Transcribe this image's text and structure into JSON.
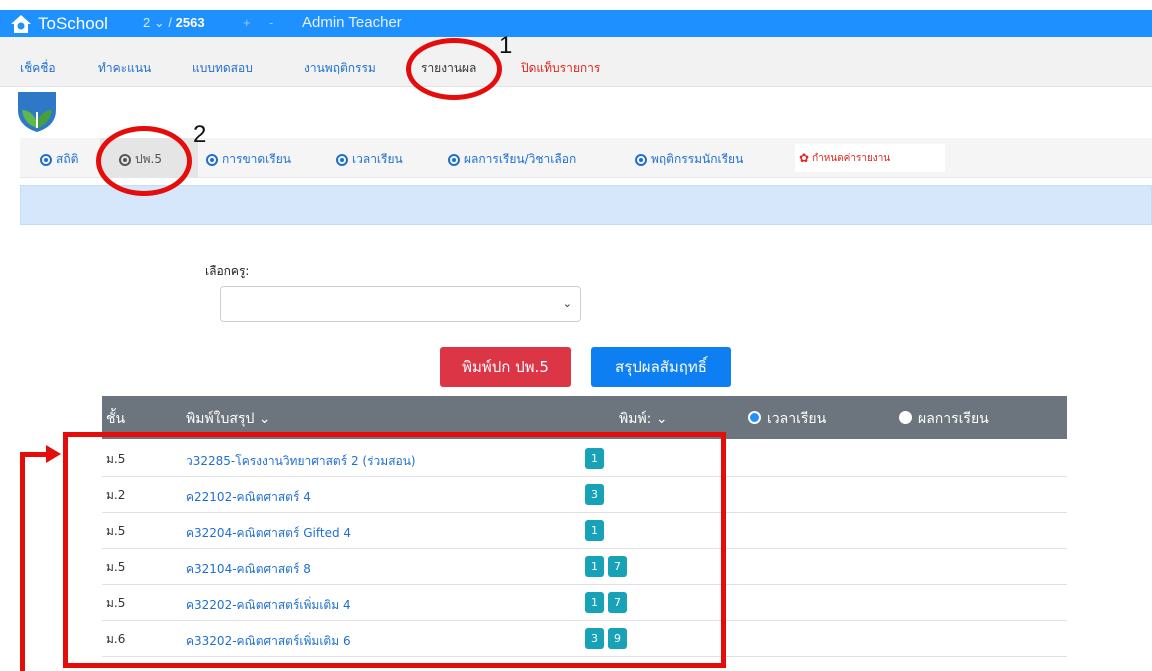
{
  "topbar": {
    "brand": "ToSchool",
    "term_sem": "2",
    "term_chev": "⌄",
    "term_sep": "/",
    "term_year": "2563",
    "plus": "+",
    "minus": "-",
    "roles": "Admin  Teacher"
  },
  "menu": {
    "items": [
      "เช็คชื่อ",
      "ทำคะแนน",
      "แบบทดสอบ",
      "งานพฤติกรรม",
      "รายงานผล",
      "ปิดแท็บรายการ"
    ]
  },
  "subtabs": {
    "items": [
      "สถิติ",
      "ปพ.5",
      "การขาดเรียน",
      "เวลาเรียน",
      "ผลการเรียน/วิชาเลือก",
      "พฤติกรรมนักเรียน"
    ],
    "config_label": "กำหนดค่ารายงาน"
  },
  "form": {
    "teacher_label": "เลือกครู:",
    "select_value": "",
    "print_cover_button": "พิมพ์ปก ปพ.5",
    "summary_button": "สรุปผลสัมฤทธิ์"
  },
  "table": {
    "headers": {
      "level": "ชั้น",
      "print_summary": "พิมพ์ใบสรุป ⌄",
      "print": "พิมพ์: ⌄",
      "attendance": "เวลาเรียน",
      "results": "ผลการเรียน"
    },
    "rows": [
      {
        "level": "ม.5",
        "subject": "ว32285-โครงงานวิทยาศาสตร์ 2 (ร่วมสอน)",
        "badges": [
          "1"
        ]
      },
      {
        "level": "ม.2",
        "subject": "ค22102-คณิตศาสตร์ 4",
        "badges": [
          "3"
        ]
      },
      {
        "level": "ม.5",
        "subject": "ค32204-คณิตศาสตร์ Gifted 4",
        "badges": [
          "1"
        ]
      },
      {
        "level": "ม.5",
        "subject": "ค32104-คณิตศาสตร์ 8",
        "badges": [
          "1",
          "7"
        ]
      },
      {
        "level": "ม.5",
        "subject": "ค32202-คณิตศาสตร์เพิ่มเติม 4",
        "badges": [
          "1",
          "7"
        ]
      },
      {
        "level": "ม.6",
        "subject": "ค33202-คณิตศาสตร์เพิ่มเติม 6",
        "badges": [
          "3",
          "9"
        ]
      }
    ]
  },
  "annotations": {
    "step1": "1",
    "step2": "2"
  },
  "colors": {
    "topbar": "#1e90ff",
    "accent_red": "#e5231b",
    "badge": "#17a2b8",
    "table_header": "#6c757d"
  }
}
